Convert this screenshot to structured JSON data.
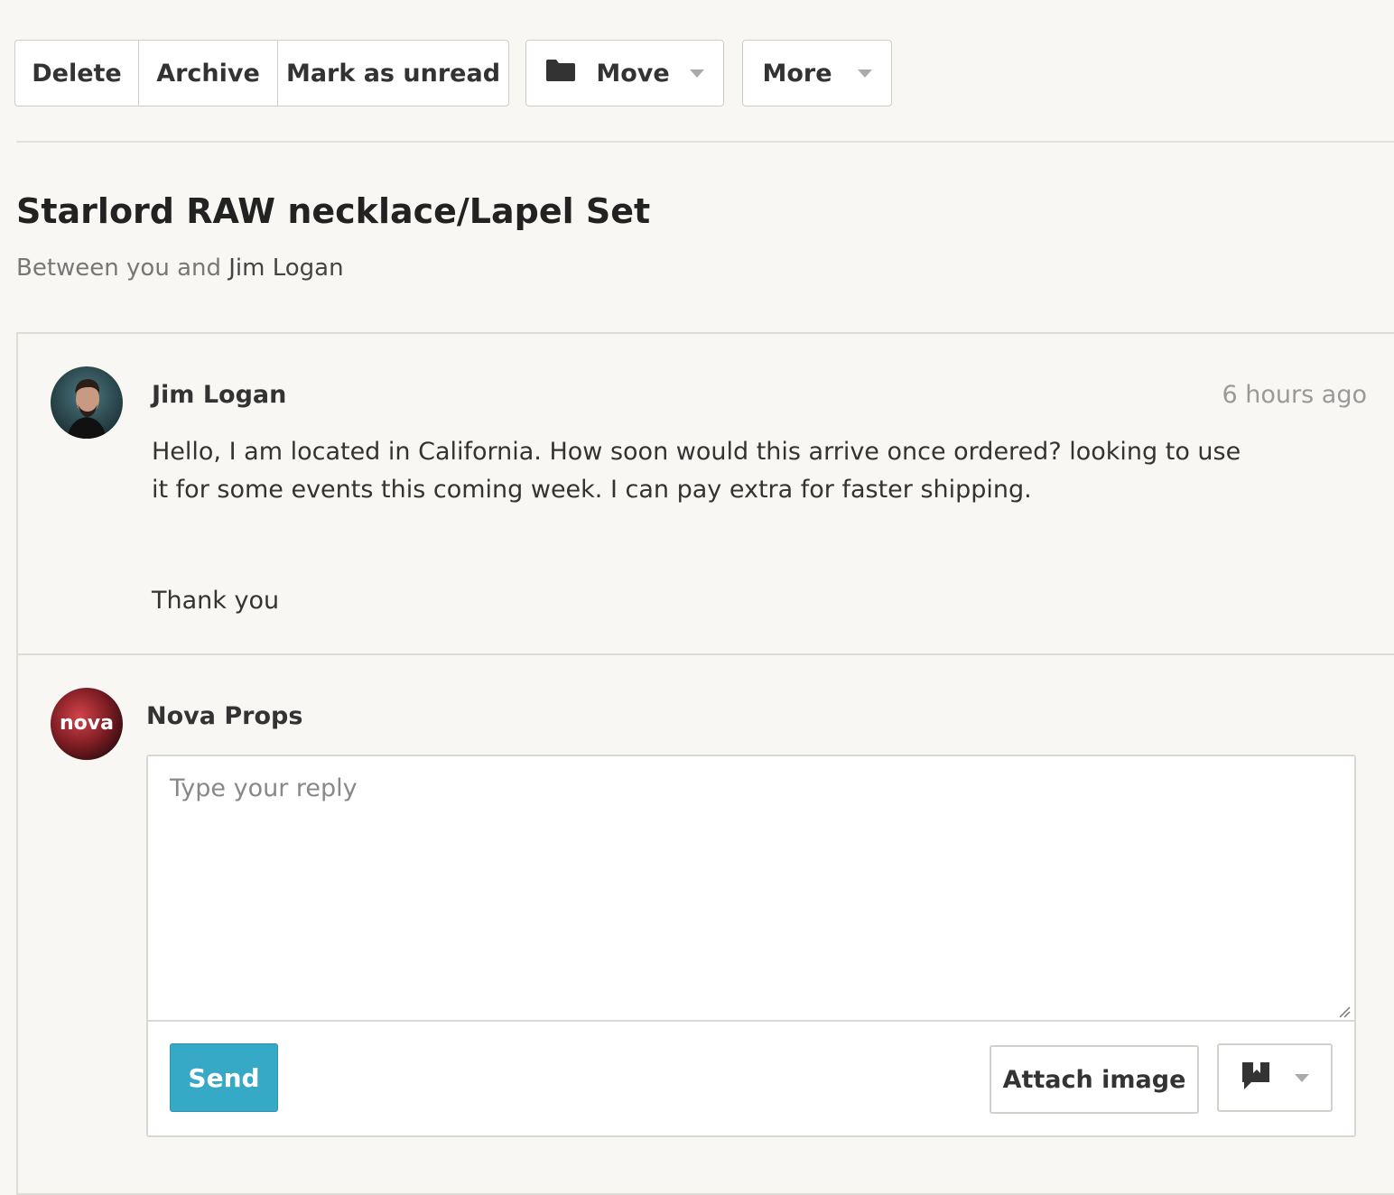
{
  "toolbar": {
    "delete_label": "Delete",
    "archive_label": "Archive",
    "mark_unread_label": "Mark as unread",
    "move_label": "Move",
    "move_icon": "folder-icon",
    "more_label": "More"
  },
  "conversation": {
    "title": "Starlord RAW necklace/Lapel Set",
    "subtitle_prefix": "Between you and",
    "participant": "Jim Logan"
  },
  "message": {
    "sender": "Jim Logan",
    "time": "6 hours ago",
    "body": "Hello, I am located in California. How soon would this arrive once ordered? looking to use it for some events this coming week. I can pay extra for faster shipping.",
    "closing": "Thank you"
  },
  "reply": {
    "sender": "Nova Props",
    "avatar_text": "nova",
    "placeholder": "Type your reply",
    "value": "",
    "send_label": "Send",
    "attach_label": "Attach image",
    "snippet_icon": "snippets-icon"
  },
  "colors": {
    "accent": "#35a9c6",
    "background": "#f8f7f3",
    "border": "#dedcd7"
  }
}
